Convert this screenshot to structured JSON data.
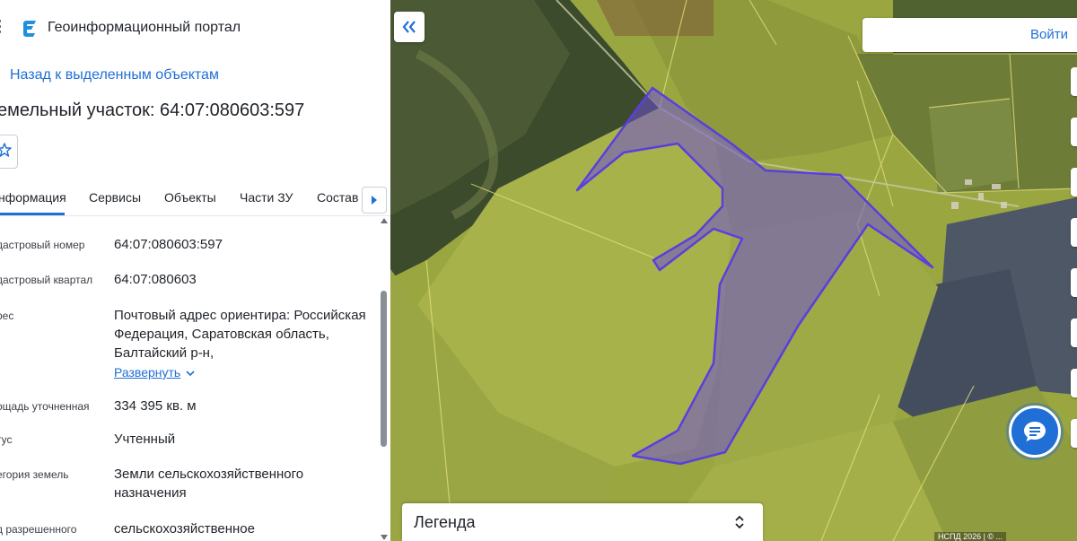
{
  "header": {
    "portal_title": "Геоинформационный портал",
    "back_link": "Назад к выделенным объектам",
    "parcel_title": "емельный участок: 64:07:080603:597"
  },
  "tabs": [
    {
      "label": "нформация",
      "active": true
    },
    {
      "label": "Сервисы"
    },
    {
      "label": "Объекты"
    },
    {
      "label": "Части ЗУ"
    },
    {
      "label": "Состав"
    }
  ],
  "info_rows": [
    {
      "label": "дастровый номер",
      "value": "64:07:080603:597"
    },
    {
      "label": "дастровый квартал",
      "value": "64:07:080603"
    },
    {
      "label": "рес",
      "value": "Почтовый адрес ориентира: Российская Федерация, Саратовская область, Балтайский р-н,"
    },
    {
      "label": "ощадь уточненная",
      "value": "334 395 кв. м"
    },
    {
      "label": "тус",
      "value": "Учтенный"
    },
    {
      "label": "егория земель",
      "value": "Земли сельскохозяйственного назначения"
    },
    {
      "label": "д разрешенного",
      "value": "сельскохозяйственное"
    }
  ],
  "expand_link": "Развернуть",
  "map": {
    "login_label": "Войти",
    "legend_title": "Легенда",
    "attribution": "НСПД 2026 | © ... ",
    "parcel_color": "#5b3fd6"
  },
  "colors": {
    "accent": "#1f6fd6",
    "parcel_outline": "#5a3ee0"
  },
  "icons": [
    "menu-icon",
    "portal-logo-icon",
    "star-icon",
    "chevron-right-icon",
    "double-chevron-left-icon",
    "chat-icon",
    "chevron-updown-icon",
    "chevron-down-icon"
  ]
}
